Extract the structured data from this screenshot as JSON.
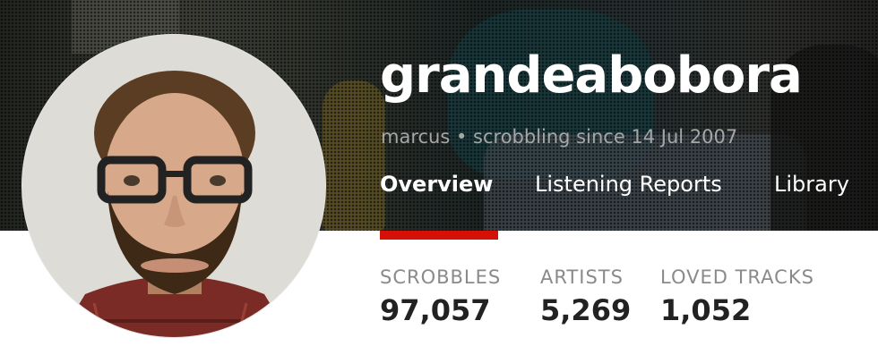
{
  "profile": {
    "username": "grandeabobora",
    "meta": "marcus • scrobbling since 14 Jul 2007"
  },
  "nav": {
    "tabs": [
      {
        "label": "Overview",
        "active": true
      },
      {
        "label": "Listening Reports",
        "active": false
      },
      {
        "label": "Library",
        "active": false
      }
    ]
  },
  "stats": [
    {
      "label": "SCROBBLES",
      "value": "97,057"
    },
    {
      "label": "ARTISTS",
      "value": "5,269"
    },
    {
      "label": "LOVED TRACKS",
      "value": "1,052"
    }
  ],
  "colors": {
    "accent": "#d51007",
    "stat_label": "#8a8a8a",
    "stat_value": "#222222",
    "meta_text": "#a6a6a6"
  }
}
